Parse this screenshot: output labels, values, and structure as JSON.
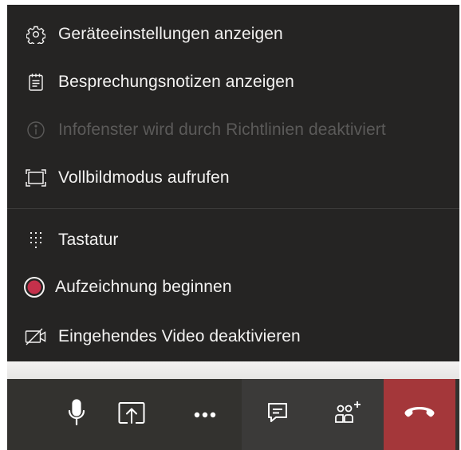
{
  "menu": {
    "items": [
      {
        "label": "Geräteeinstellungen anzeigen",
        "icon": "gear-icon",
        "enabled": true
      },
      {
        "label": "Besprechungsnotizen anzeigen",
        "icon": "notes-icon",
        "enabled": true
      },
      {
        "label": "Infofenster wird durch Richtlinien deaktiviert",
        "icon": "info-icon",
        "enabled": false
      },
      {
        "label": "Vollbildmodus aufrufen",
        "icon": "fullscreen-icon",
        "enabled": true
      },
      {
        "label": "Tastatur",
        "icon": "dialpad-icon",
        "enabled": true
      },
      {
        "label": "Aufzeichnung beginnen",
        "icon": "record-icon",
        "enabled": true
      },
      {
        "label": "Eingehendes Video deaktivieren",
        "icon": "video-off-icon",
        "enabled": true
      }
    ]
  },
  "toolbar": {
    "buttons": [
      {
        "icon": "microphone-icon"
      },
      {
        "icon": "share-screen-icon"
      },
      {
        "icon": "more-options-icon"
      },
      {
        "icon": "chat-icon"
      },
      {
        "icon": "participants-icon"
      },
      {
        "icon": "hang-up-icon"
      }
    ]
  },
  "colors": {
    "menu_bg": "#252423",
    "text": "#f3f2f1",
    "disabled_text": "#5b5a59",
    "record_red": "#c4314b",
    "hangup_bg": "#a4373a",
    "toolbar_bg": "#33322f"
  }
}
